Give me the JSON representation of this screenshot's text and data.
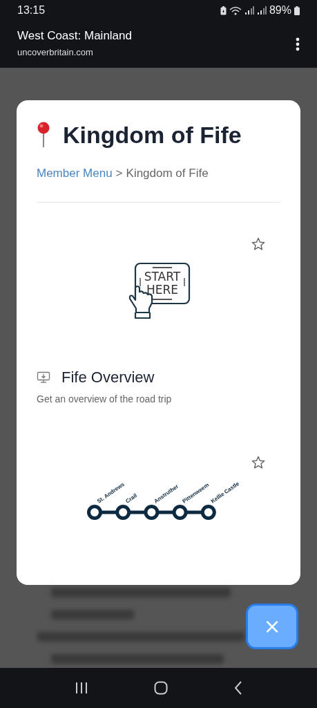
{
  "status_bar": {
    "time": "13:15",
    "battery": "89%"
  },
  "browser": {
    "title": "West Coast: Mainland",
    "url": "uncoverbritain.com"
  },
  "card": {
    "title": "Kingdom of Fife",
    "breadcrumb": {
      "link": "Member Menu",
      "separator": ">",
      "current": "Kingdom of Fife"
    },
    "items": [
      {
        "kind": "start",
        "favorite": false,
        "sign_lines": [
          "START",
          "HERE"
        ]
      },
      {
        "kind": "section",
        "title": "Fife Overview",
        "description": "Get an overview of the road trip"
      },
      {
        "kind": "route",
        "favorite": false,
        "stops": [
          "St. Andrews",
          "Crail",
          "Anstruther",
          "Pittenweem",
          "Kellie Castle"
        ]
      }
    ]
  },
  "close_button": {
    "label": "×"
  }
}
